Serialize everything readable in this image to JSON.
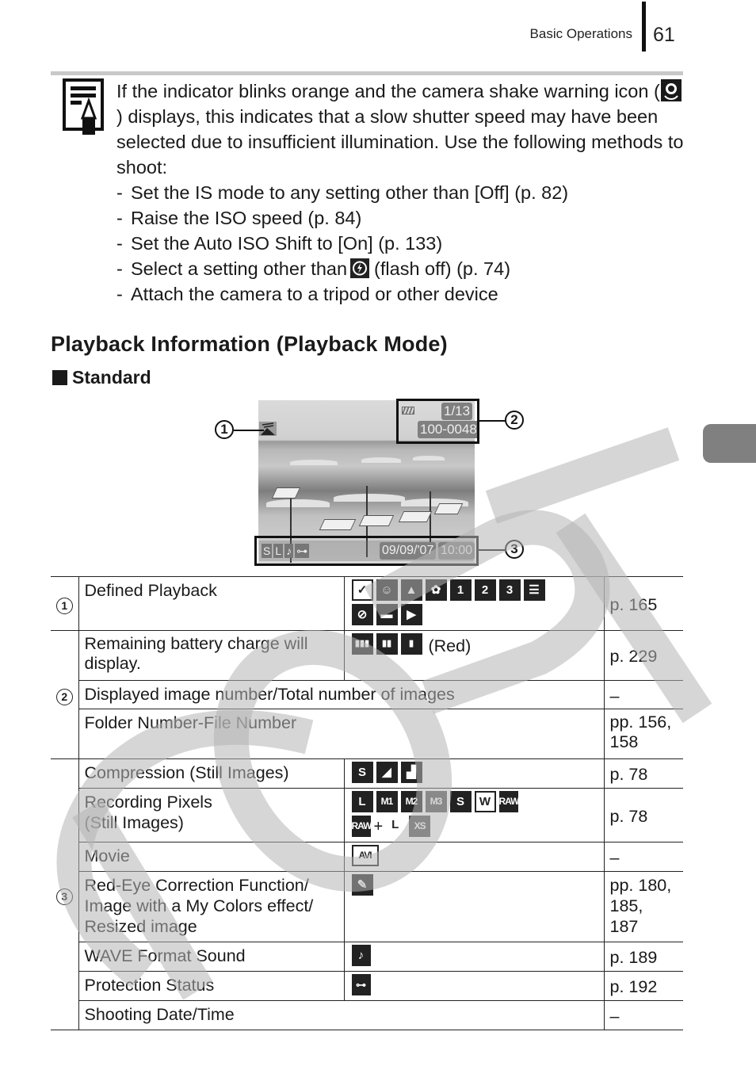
{
  "header": {
    "section": "Basic Operations",
    "page_number": "61"
  },
  "note": {
    "icon": "memo-pencil-icon",
    "text_part1": "If the indicator blinks orange and the camera shake warning icon (",
    "inline_icon": "camera-shake-icon",
    "text_part2": ") displays, this indicates that a slow shutter speed may have been selected due to insufficient illumination. Use the following methods to shoot:",
    "items": [
      {
        "text": "Set the IS mode to any setting other than [Off] (p. 82)"
      },
      {
        "text": "Raise the ISO speed (p. 84)"
      },
      {
        "text": "Set the Auto ISO Shift to [On] (p. 133)"
      },
      {
        "text_before": "Select a setting other than",
        "icon": "flash-off-icon",
        "text_after": "(flash off) (p. 74)"
      },
      {
        "text": "Attach the camera to a tripod or other device"
      }
    ],
    "dash": "-"
  },
  "section_title": "Playback Information (Playback Mode)",
  "subsection_title": "Standard",
  "display": {
    "image_counter": "1/13",
    "file_number": "100-0048",
    "date": "09/09/'07",
    "time": "10:00",
    "bottom_icons": [
      "S",
      "L",
      "♪",
      "⊶"
    ],
    "callouts": [
      "1",
      "2",
      "3"
    ]
  },
  "table": {
    "rows": [
      {
        "group": "1",
        "desc": "Defined Playback",
        "icons": [
          "favorites-clock-icon",
          "people-icon",
          "scenery-icon",
          "events-icon",
          "my-category-1-icon",
          "my-category-2-icon",
          "my-category-3-icon",
          "to-do-icon",
          "no-category-icon",
          "folder-icon",
          "movie-icon"
        ],
        "ref": "p. 165"
      },
      {
        "group": "2",
        "desc": "Remaining battery charge will display.",
        "icons": [
          "battery-full-icon",
          "battery-half-icon",
          "battery-low-icon"
        ],
        "icon_note": "(Red)",
        "ref": "p. 229"
      },
      {
        "group": "2",
        "desc": "Displayed image number/Total number of images",
        "ref": "–"
      },
      {
        "group": "2",
        "desc": "Folder Number-File Number",
        "ref": "pp. 156, 158"
      },
      {
        "group": "3",
        "desc": "Compression (Still Images)",
        "icons": [
          "superfine-icon",
          "fine-icon",
          "normal-icon"
        ],
        "ref": "p. 78"
      },
      {
        "group": "3",
        "desc_line1": "Recording Pixels",
        "desc_line2": "(Still Images)",
        "icon_labels": [
          "L",
          "M1",
          "M2",
          "M3",
          "S",
          "W",
          "RAW",
          "RAW",
          "+",
          "L",
          "XS"
        ],
        "ref": "p. 78"
      },
      {
        "group": "3",
        "desc": "Movie",
        "icon_labels": [
          "AVI"
        ],
        "ref": "–"
      },
      {
        "group": "3",
        "desc_line1": "Red-Eye Correction Function/",
        "desc_line2": "Image with a My Colors effect/",
        "desc_line3": "Resized image",
        "icons": [
          "retouch-brush-icon"
        ],
        "ref_line1": "pp. 180,",
        "ref_line2": "185,",
        "ref_line3": "187"
      },
      {
        "group": "3",
        "desc": "WAVE Format Sound",
        "icons": [
          "sound-memo-icon"
        ],
        "ref": "p. 189"
      },
      {
        "group": "3",
        "desc": "Protection Status",
        "icons": [
          "protect-key-icon"
        ],
        "ref": "p. 192"
      },
      {
        "group": "3",
        "desc": "Shooting Date/Time",
        "ref": "–"
      }
    ]
  },
  "watermark_text": "COPY"
}
